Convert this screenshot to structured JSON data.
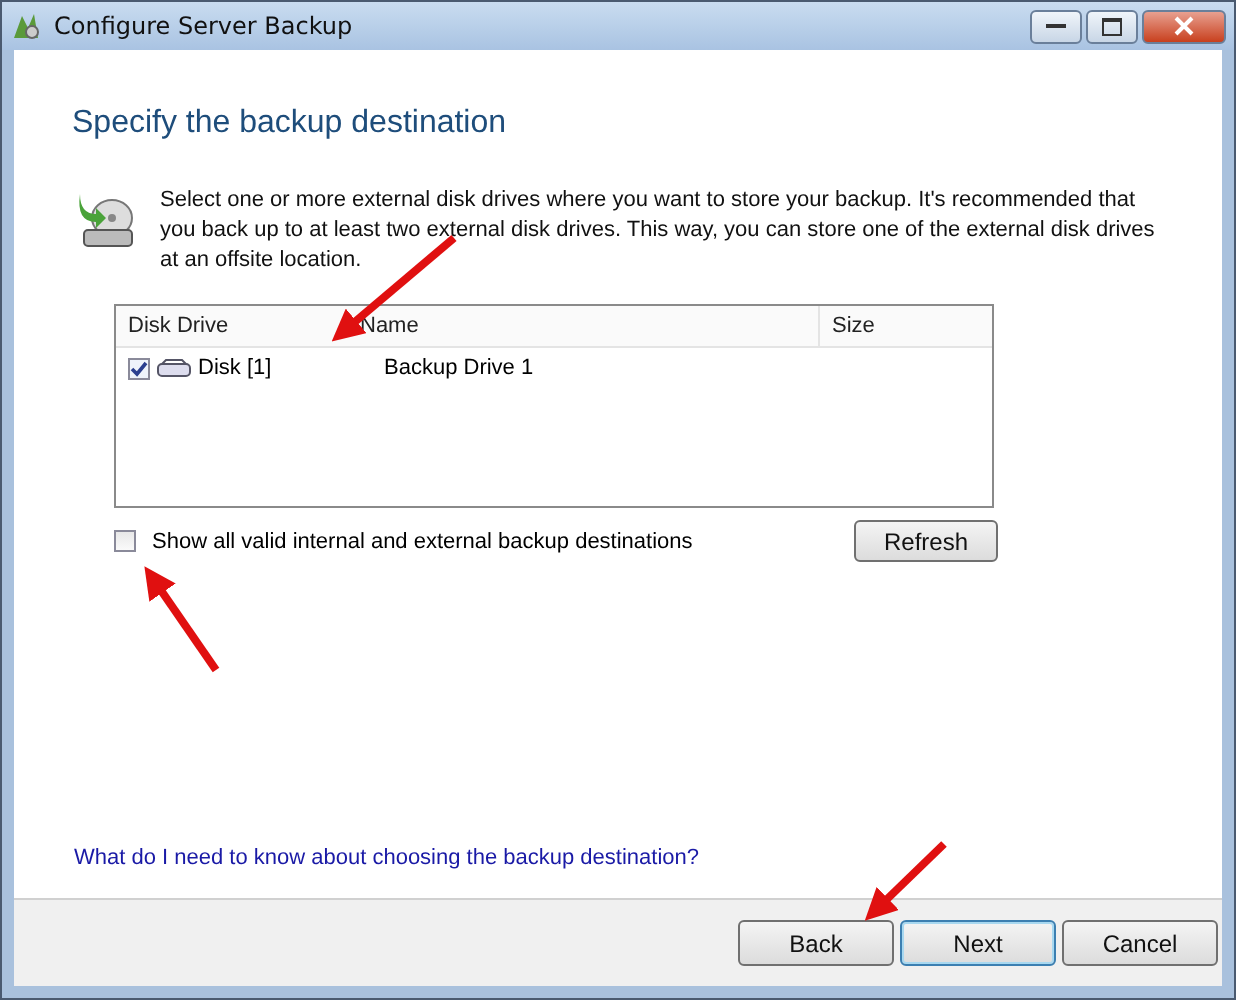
{
  "window": {
    "title": "Configure Server Backup"
  },
  "heading": "Specify the backup destination",
  "intro": "Select one or more external disk drives where you want to store your backup. It's recommended that you back up to at least two external disk drives. This way, you can store one of the external disk drives at an offsite location.",
  "table": {
    "columns": [
      "Disk Drive",
      "Name",
      "Size"
    ],
    "rows": [
      {
        "checked": true,
        "disk": "Disk [1]",
        "name": "Backup Drive 1"
      }
    ]
  },
  "show_all": {
    "label": "Show all valid internal and external backup destinations",
    "checked": false
  },
  "refresh_button": "Refresh",
  "help_link": "What do I need to know about choosing the backup destination?",
  "buttons": [
    {
      "label": "Back",
      "default": false
    },
    {
      "label": "Next",
      "default": true
    },
    {
      "label": "Cancel",
      "default": false
    }
  ]
}
